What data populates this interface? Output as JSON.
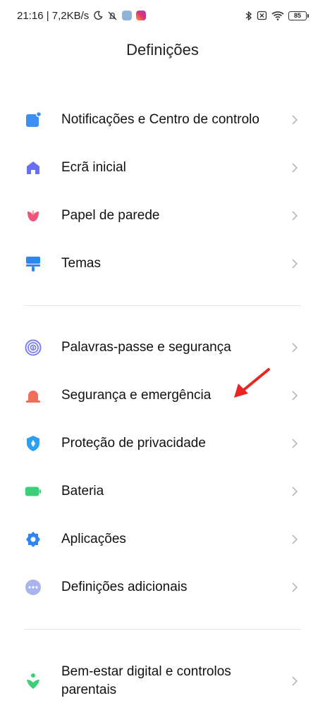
{
  "status_bar": {
    "time_info": "21:16 | 7,2KB/s",
    "battery": "85"
  },
  "page": {
    "title": "Definições"
  },
  "items": [
    {
      "label": "Notificações e Centro de controlo",
      "icon": "notifications-icon",
      "color": "#3d8ef5"
    },
    {
      "label": "Ecrã inicial",
      "icon": "home-icon",
      "color": "#6a6ef0"
    },
    {
      "label": "Papel de parede",
      "icon": "tulip-icon",
      "color": "#f0527a"
    },
    {
      "label": "Temas",
      "icon": "brush-icon",
      "color": "#2f86f2"
    },
    {
      "label": "Palavras-passe e segurança",
      "icon": "fingerprint-icon",
      "color": "#7c7ff0"
    },
    {
      "label": "Segurança e emergência",
      "icon": "alarm-light-icon",
      "color": "#f26d5a"
    },
    {
      "label": "Proteção de privacidade",
      "icon": "shield-icon",
      "color": "#2aa0f0"
    },
    {
      "label": "Bateria",
      "icon": "battery-icon",
      "color": "#3ccf7a"
    },
    {
      "label": "Aplicações",
      "icon": "gear-icon",
      "color": "#2f86f2"
    },
    {
      "label": "Definições adicionais",
      "icon": "more-icon",
      "color": "#a7b4ee"
    },
    {
      "label": "Bem-estar digital e controlos parentais",
      "icon": "wellbeing-icon",
      "color": "#3ccf7a"
    }
  ],
  "annotation": {
    "icon": "red-arrow-icon",
    "color": "#e8261f"
  }
}
